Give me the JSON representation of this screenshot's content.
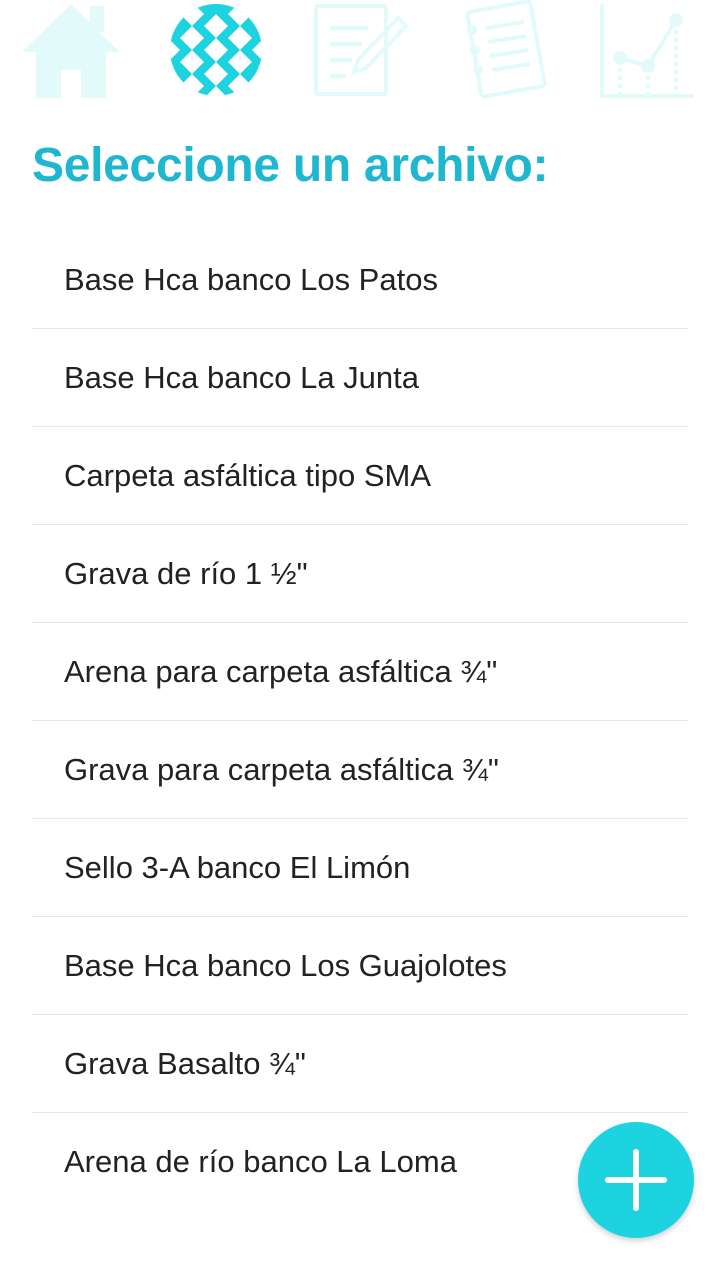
{
  "colors": {
    "accent": "#1dbfd4",
    "nav_inactive": "#e3fafb",
    "title": "#1fb6cf",
    "fab": "#1dd3e0"
  },
  "topnav": {
    "items": [
      {
        "icon": "home-icon",
        "active": false
      },
      {
        "icon": "sieve-mesh-icon",
        "active": true
      },
      {
        "icon": "edit-document-icon",
        "active": false
      },
      {
        "icon": "notebook-icon",
        "active": false
      },
      {
        "icon": "line-chart-icon",
        "active": false
      }
    ]
  },
  "title": "Seleccione un archivo:",
  "files": [
    "Base Hca banco Los Patos",
    "Base Hca banco La Junta",
    "Carpeta asfáltica tipo SMA",
    "Grava de río 1 ½\"",
    "Arena para carpeta asfáltica ¾\"",
    "Grava para carpeta asfáltica ¾\"",
    "Sello 3-A banco El Limón",
    "Base Hca banco Los Guajolotes",
    "Grava Basalto ¾\"",
    "Arena de río banco La Loma"
  ],
  "fab": {
    "icon": "plus-icon"
  }
}
